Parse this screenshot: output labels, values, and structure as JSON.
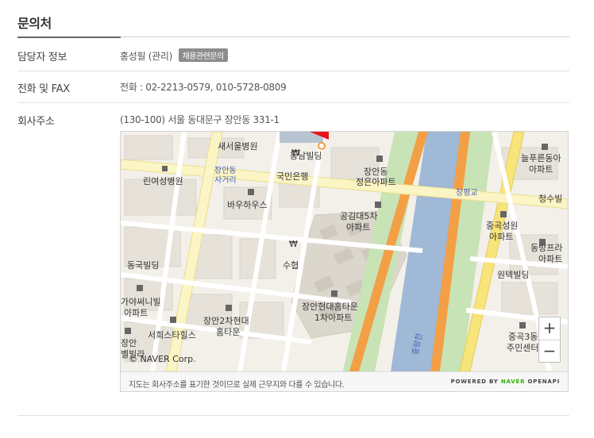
{
  "section": {
    "title": "문의처"
  },
  "rows": {
    "contact": {
      "label": "담당자 정보",
      "name": "홍성필 (관리)",
      "badge": "채용관련문의"
    },
    "phone": {
      "label": "전화 및 FAX",
      "value": "전화 : 02-2213-0579, 010-5728-0809"
    },
    "address": {
      "label": "회사주소",
      "value": "(130-100) 서울 동대문구 장안동 331-1"
    }
  },
  "map": {
    "labels": {
      "l1": "새서울병원",
      "l2": "동남빌딩",
      "l3": "장안동",
      "l4": "사거리",
      "l5": "국민은행",
      "l6": "장안동",
      "l7": "정은아파트",
      "l8": "장평교",
      "l9": "늘푸른동아",
      "l10": "아파트",
      "l11": "린여성병원",
      "l12": "바우하우스",
      "l13": "공김대5차",
      "l14": "아파트",
      "l15": "청수빌",
      "l16": "중곡성원",
      "l17": "아파트",
      "l18": "동방프라",
      "l19": "아파트",
      "l20": "동국빌딩",
      "l21": "수협",
      "l22": "원텍빌딩",
      "l23": "가야써니빌",
      "l24": "아파트",
      "l25": "장안현대홈타운",
      "l26": "1차아파트",
      "l27": "장안2차현대",
      "l28": "홈타운",
      "l29": "서희스타힐스",
      "l30": "중랑천",
      "l31": "중곡3동",
      "l32": "주민센터",
      "l33": "장안",
      "l34": "벨빌라"
    },
    "copyright": "© NAVER Corp.",
    "zoom_in": "+",
    "zoom_out": "−",
    "footer_note": "지도는 회사주소를 표기한 것이므로 실제 근무지와 다를 수 있습니다.",
    "powered_prefix": "POWERED BY",
    "powered_naver": "NAVER",
    "powered_suffix": "OPENAPI"
  }
}
